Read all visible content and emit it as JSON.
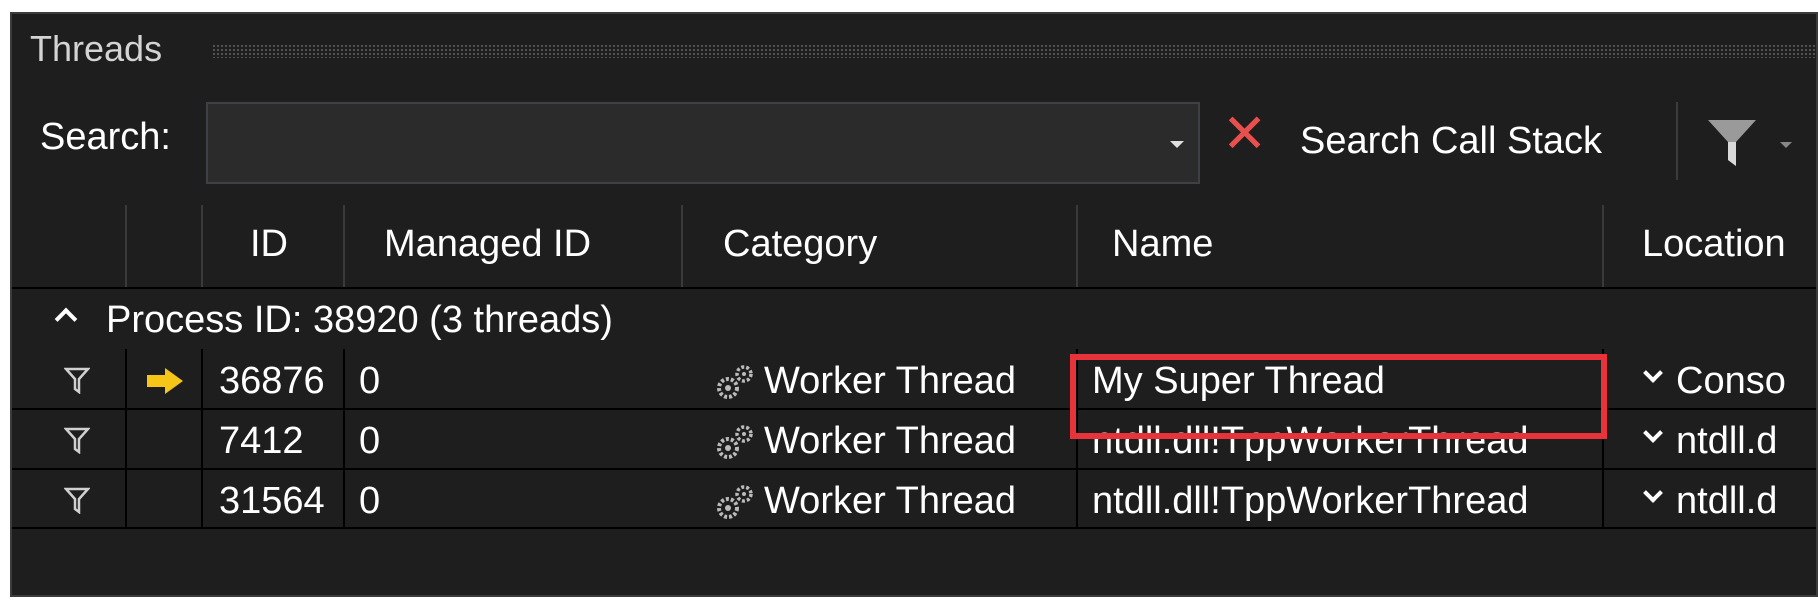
{
  "window": {
    "title": "Threads"
  },
  "toolbar": {
    "search_label": "Search:",
    "search_value": "",
    "search_call_stack_label": "Search Call Stack"
  },
  "columns": [
    "",
    "",
    "ID",
    "Managed ID",
    "Category",
    "Name",
    "Location"
  ],
  "group": {
    "label": "Process ID: 38920  (3 threads)"
  },
  "threads": [
    {
      "id": "36876",
      "managed_id": "0",
      "category": "Worker Thread",
      "name": "My Super Thread",
      "location": "Conso",
      "current": true
    },
    {
      "id": "7412",
      "managed_id": "0",
      "category": "Worker Thread",
      "name": "ntdll.dll!TppWorkerThread",
      "location": "ntdll.d",
      "current": false
    },
    {
      "id": "31564",
      "managed_id": "0",
      "category": "Worker Thread",
      "name": "ntdll.dll!TppWorkerThread",
      "location": "ntdll.d",
      "current": false
    }
  ],
  "colors": {
    "highlight": "#e8333a",
    "current_arrow": "#f5c518",
    "clear_icon": "#e8504e"
  },
  "icons": {
    "flag": "flag-icon",
    "current": "current-thread-arrow-icon",
    "category": "gears-icon",
    "filter": "filter-icon",
    "clear": "clear-icon"
  }
}
